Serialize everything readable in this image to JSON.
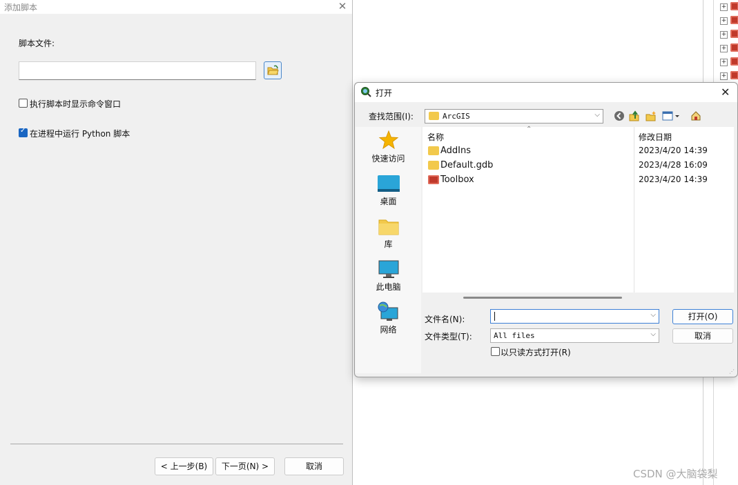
{
  "wizard": {
    "title": "添加脚本",
    "script_file_label": "脚本文件:",
    "script_file_value": "",
    "show_cmd_label": "执行脚本时显示命令窗口",
    "show_cmd_checked": false,
    "run_in_process_label": "在进程中运行 Python 脚本",
    "run_in_process_checked": true,
    "back_label": "< 上一步(B)",
    "next_label": "下一页(N) >",
    "cancel_label": "取消"
  },
  "open_dialog": {
    "title": "打开",
    "look_in_label": "查找范围(I):",
    "look_in_value": "ArcGIS",
    "places": [
      {
        "label": "快速访问",
        "icon": "star-icon"
      },
      {
        "label": "桌面",
        "icon": "desktop-icon"
      },
      {
        "label": "库",
        "icon": "library-folder-icon"
      },
      {
        "label": "此电脑",
        "icon": "computer-icon"
      },
      {
        "label": "网络",
        "icon": "network-icon"
      }
    ],
    "columns": {
      "name": "名称",
      "modified": "修改日期"
    },
    "files": [
      {
        "name": "AddIns",
        "modified": "2023/4/20 14:39",
        "icon": "folder-icon"
      },
      {
        "name": "Default.gdb",
        "modified": "2023/4/28 16:09",
        "icon": "folder-icon"
      },
      {
        "name": "Toolbox",
        "modified": "2023/4/20 14:39",
        "icon": "toolbox-icon"
      }
    ],
    "file_name_label": "文件名(N):",
    "file_name_value": "",
    "file_type_label": "文件类型(T):",
    "file_type_value": "All files",
    "read_only_label": "以只读方式打开(R)",
    "open_button": "打开(O)",
    "cancel_button": "取消"
  },
  "watermark": "CSDN @大脑袋梨",
  "colors": {
    "accent": "#1a66c2",
    "folder": "#f2c94c",
    "toolbox": "#c0392b"
  }
}
